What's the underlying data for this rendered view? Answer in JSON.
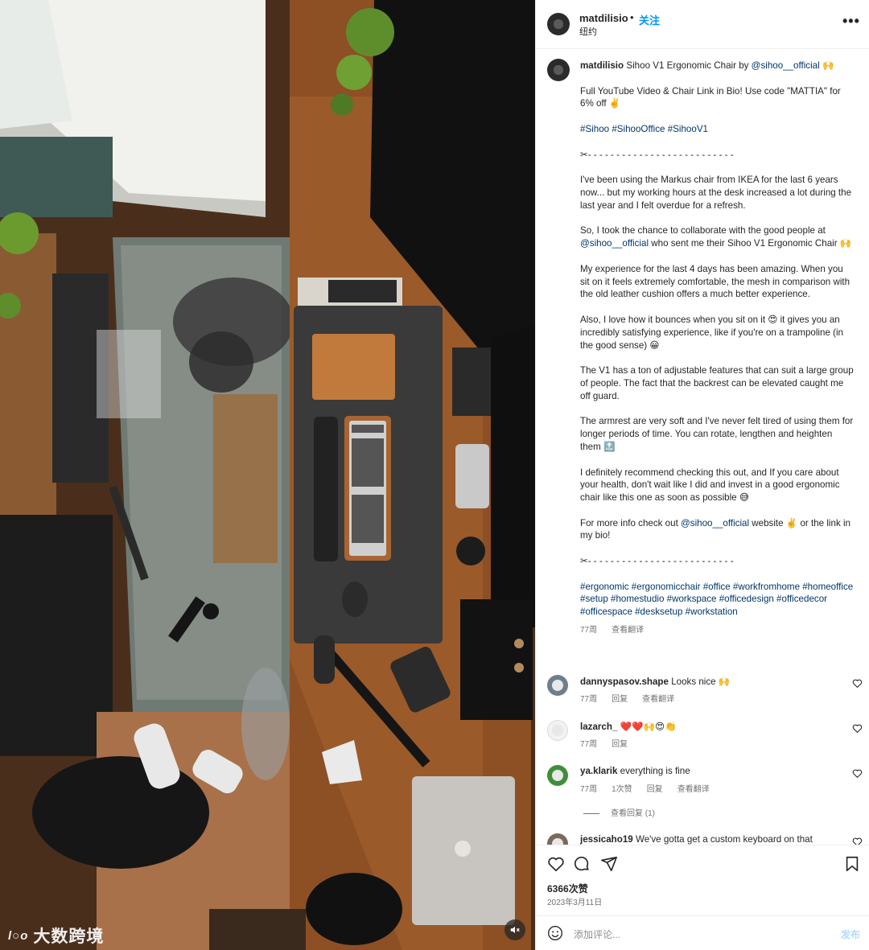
{
  "media": {
    "watermark_logo": "l○o",
    "watermark_text": "大数跨境"
  },
  "header": {
    "username": "matdilisio",
    "separator": "•",
    "follow_label": "关注",
    "location": "纽约",
    "more_label": "•••"
  },
  "caption": {
    "username": "matdilisio",
    "title_prefix": "Sihoo V1 Ergonomic Chair by ",
    "title_mention": "@sihoo__official",
    "title_suffix": " 🙌",
    "p1": "Full YouTube Video & Chair Link in Bio! Use code \"MATTIA\" for 6% off ✌️",
    "hashtags1": "#Sihoo #SihooOffice #SihooV1",
    "divider1": "✂- - - - - - - - - - - - - - - - - - - - - - - - - -",
    "p2": "I've been using the Markus chair from IKEA for the last 6 years now... but my working hours at the desk increased a lot during the last year and I felt overdue for a refresh.",
    "p3_prefix": "So, I took the chance to collaborate with the good people at ",
    "p3_mention": "@sihoo__official",
    "p3_suffix": " who sent me their Sihoo V1 Ergonomic Chair 🙌",
    "p4": "My experience for the last 4 days has been amazing. When you sit on it feels extremely comfortable, the mesh in comparison with the old leather cushion offers a much better experience.",
    "p5": "Also, I love how it bounces when you sit on it 😍 it gives you an incredibly satisfying experience, like if you're on a trampoline (in the good sense) 😀",
    "p6": "The V1 has a ton of adjustable features that can suit a large group of people. The fact that the backrest can be elevated caught me off guard.",
    "p7": "The armrest are very soft and I've never felt tired of using them for longer periods of time. You can rotate, lengthen and heighten them 🔝",
    "p8": "I definitely recommend checking this out, and If you care about your health, don't wait like I did and invest in a good ergonomic chair like this one as soon as possible 😅",
    "p9_prefix": "For more info check out ",
    "p9_mention": "@sihoo__official",
    "p9_suffix": " website ✌️ or the link in my bio!",
    "divider2": "✂- - - - - - - - - - - - - - - - - - - - - - - - - -",
    "hashtags2": "#ergonomic #ergonomicchair #office #workfromhome #homeoffice #setup #homestudio #workspace #officedesign #officedecor #officespace #desksetup #workstation",
    "time": "77周",
    "translate": "查看翻译"
  },
  "comments": [
    {
      "username": "dannyspasov.shape",
      "text": "Looks nice 🙌",
      "time": "77周",
      "actions": [
        "回复",
        "查看翻译"
      ],
      "avatar_color": "#6d7f8c"
    },
    {
      "username": "lazarch_",
      "text": "❤️❤️🙌😍👏",
      "time": "77周",
      "actions": [
        "回复"
      ],
      "avatar_color": "#f2f2f2"
    },
    {
      "username": "ya.klarik",
      "text": "everything is fine",
      "time": "77周",
      "actions": [
        "1次赞",
        "回复",
        "查看翻译"
      ],
      "avatar_color": "#3f8f3a"
    },
    {
      "username": "jessicaho19",
      "text": "We've gotta get a custom keyboard on that",
      "time": "",
      "actions": [],
      "avatar_color": "#7a6a5a"
    }
  ],
  "view_replies": "查看回复 (1)",
  "likes": "6366次赞",
  "date": "2023年3月11日",
  "composer": {
    "placeholder": "添加评论...",
    "post_label": "发布"
  },
  "icons": {
    "like": "heart-icon",
    "comment": "comment-icon",
    "share": "share-icon",
    "save": "bookmark-icon",
    "emoji": "emoji-icon",
    "mute": "speaker-muted-icon"
  },
  "colors": {
    "link": "#00376b",
    "follow": "#0095f6",
    "secondary": "#737373",
    "post_disabled": "#b3dbff"
  }
}
